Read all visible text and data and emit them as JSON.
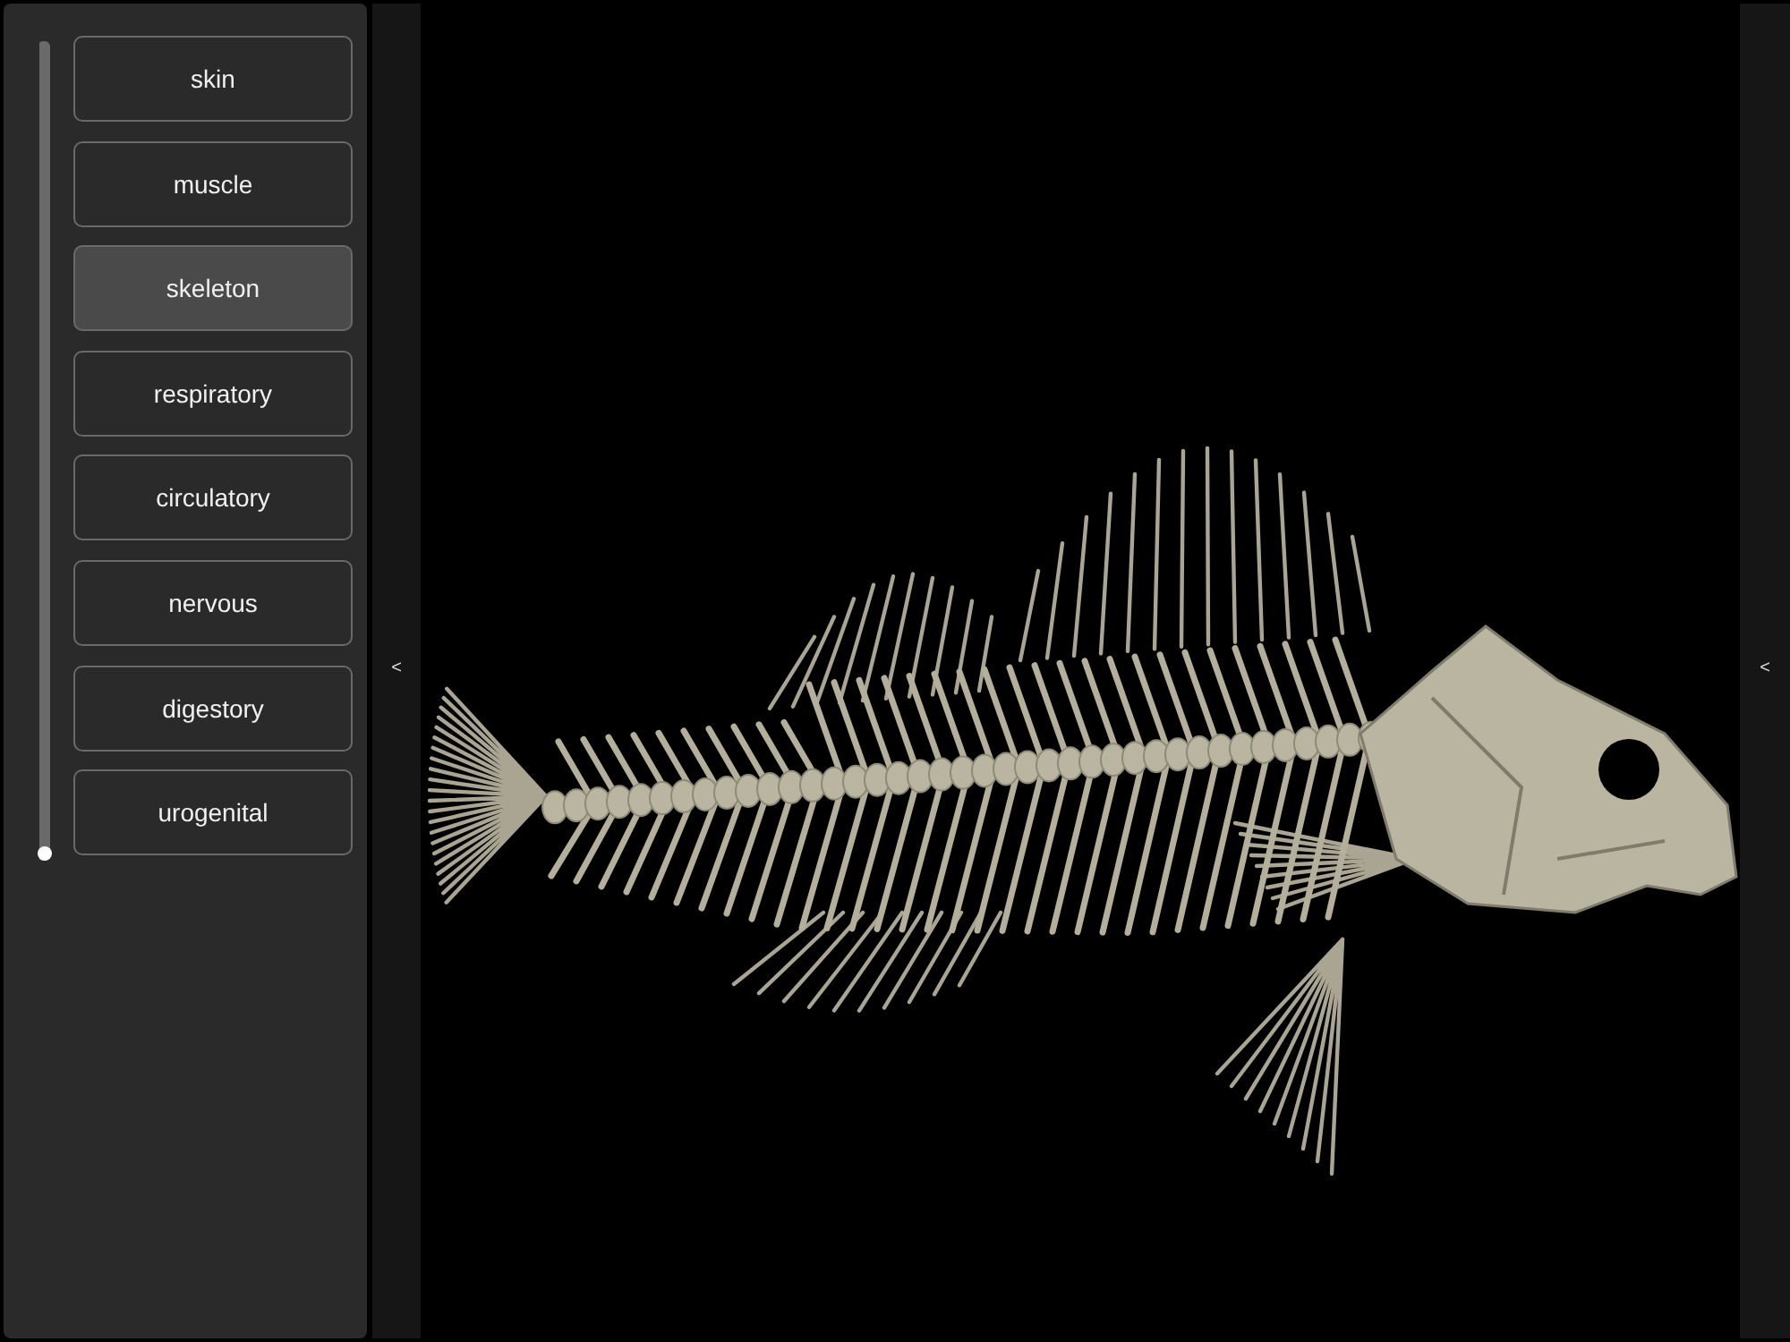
{
  "layers": [
    {
      "label": "skin",
      "selected": false
    },
    {
      "label": "muscle",
      "selected": false
    },
    {
      "label": "skeleton",
      "selected": true
    },
    {
      "label": "respiratory",
      "selected": false
    },
    {
      "label": "circulatory",
      "selected": false
    },
    {
      "label": "nervous",
      "selected": false
    },
    {
      "label": "digestory",
      "selected": false
    },
    {
      "label": "urogenital",
      "selected": false
    }
  ],
  "slider": {
    "level": 0
  },
  "left_handle": {
    "label": "<"
  },
  "right_handle": {
    "label": "<"
  }
}
